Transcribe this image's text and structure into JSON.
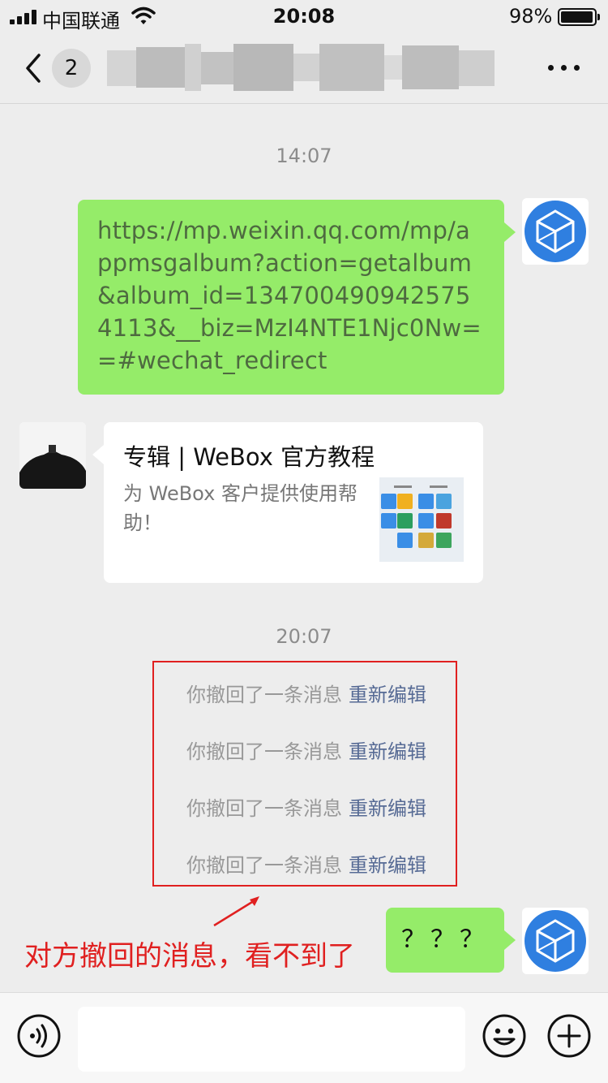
{
  "status_bar": {
    "carrier": "中国联通",
    "time": "20:08",
    "battery": "98%",
    "battery_level": 0.98
  },
  "nav": {
    "unread_count": "2"
  },
  "messages": {
    "time_1": "14:07",
    "link_text": "https://mp.weixin.qq.com/mp/appmsgalbum?action=getalbum&album_id=1347004909425754113&__biz=MzI4NTE1Njc0Nw==#wechat_redirect",
    "card": {
      "title": "专辑 | WeBox 官方教程",
      "description": "为 WeBox 客户提供使用帮助！"
    },
    "time_2": "20:07",
    "recall": [
      {
        "text": "你撤回了一条消息",
        "action": "重新编辑"
      },
      {
        "text": "你撤回了一条消息",
        "action": "重新编辑"
      },
      {
        "text": "你撤回了一条消息",
        "action": "重新编辑"
      },
      {
        "text": "你撤回了一条消息",
        "action": "重新编辑"
      }
    ],
    "last_message": "？？？"
  },
  "annotation": "对方撤回的消息，看不到了",
  "input": {
    "value": ""
  },
  "colors": {
    "bubble_green": "#95ec69",
    "link_text": "#4e6a40",
    "re_edit_link": "#576b95",
    "annotation_red": "#e02020",
    "background": "#ededed"
  }
}
